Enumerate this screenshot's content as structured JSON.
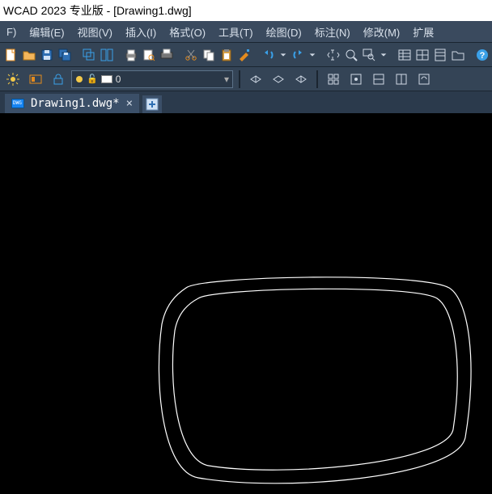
{
  "titlebar": {
    "text": "WCAD 2023 专业版 - [Drawing1.dwg]"
  },
  "menu": {
    "items": [
      {
        "label": "F)"
      },
      {
        "label": "编辑(E)"
      },
      {
        "label": "视图(V)"
      },
      {
        "label": "插入(I)"
      },
      {
        "label": "格式(O)"
      },
      {
        "label": "工具(T)"
      },
      {
        "label": "绘图(D)"
      },
      {
        "label": "标注(N)"
      },
      {
        "label": "修改(M)"
      },
      {
        "label": "扩展"
      }
    ]
  },
  "toolbar1": {
    "groups": [
      [
        "new-doc-icon",
        "open-icon",
        "save-icon",
        "saveall-icon"
      ],
      [
        "window-cascade-icon",
        "window-tile-icon"
      ],
      [
        "print-icon",
        "print-preview-icon",
        "plot-icon"
      ],
      [
        "cut-icon",
        "copy-icon",
        "paste-icon",
        "match-icon"
      ],
      [
        "undo-icon",
        "undo-dd",
        "redo-icon",
        "redo-dd"
      ],
      [
        "pan-icon",
        "zoom-extents-icon",
        "zoom-window-icon",
        "zoom-dd"
      ],
      [
        "table-icon",
        "grid-icon",
        "props-icon",
        "folder-icon"
      ],
      [
        "help-icon"
      ]
    ]
  },
  "toolbar2": {
    "left_icons": [
      "sun-icon",
      "layer-state-icon",
      "layer-lock-icon"
    ],
    "layer": {
      "lock": "🔓",
      "name": "0"
    },
    "right_groups": [
      [
        "iso-left-icon",
        "iso-top-icon",
        "iso-right-icon"
      ],
      [
        "block-icon",
        "block-edit-icon",
        "block-ref-icon",
        "block-attr-icon",
        "block-sync-icon"
      ]
    ]
  },
  "tabs": {
    "active": {
      "name": "Drawing1.dwg*",
      "close": "×"
    },
    "newtab": {
      "glyph": "+"
    }
  }
}
